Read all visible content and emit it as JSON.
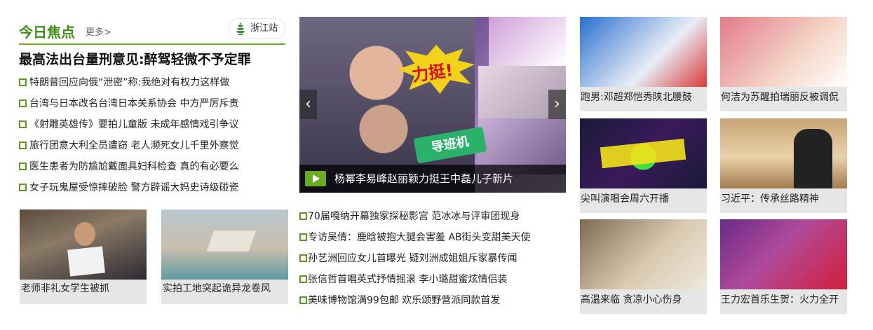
{
  "focus": {
    "title": "今日焦点",
    "more": "更多>",
    "station": "浙江站",
    "headline": "最高法出台量刑意见:醉驾轻微不予定罪",
    "items": [
      "特朗普回应向俄“泄密”称:我绝对有权力这样做",
      "台湾与日本改名台湾日本关系协会 中方严厉斥责",
      "《射雕英雄传》要拍儿童版 未成年感情戏引争议",
      "旅行团意大利全员遭窃 老人濒死女儿千里外察觉",
      "医生患者为防尴尬戴面具妇科检查 真的有必要么",
      "女子玩鬼屋受惊摔破脸 警方辟谣大妈史诗级碰瓷"
    ]
  },
  "thumbs": [
    {
      "caption": "老师非礼女学生被抓"
    },
    {
      "caption": "实拍工地突起诡异龙卷风"
    }
  ],
  "carousel": {
    "caption": "杨幂李易峰赵丽颖力挺王中磊儿子新片",
    "burst_text": "力挺!",
    "badge_text": "导班机",
    "prev_icon": "‹",
    "next_icon": "›"
  },
  "mid_list": [
    "70届嘎纳开幕独家探秘影宫 范冰冰与评审团现身",
    "专访吴倩：鹿晗被抱大腿会害羞 AB街头变甜美天使",
    "孙艺洲回应女儿首曝光 疑刘洲成姐姐斥家暴传闻",
    "张信哲首唱英式抒情摇滚 李小璐甜蜜炫情侣装",
    "美味博物馆满99包邮 欢乐颂野营派同款首发"
  ],
  "grid": [
    {
      "caption": "跑男:邓超郑恺秀陕北腰鼓",
      "colors": [
        "#2a6fd0",
        "#e8eef7"
      ]
    },
    {
      "caption": "何洁为苏醒拍瑞丽反被调侃",
      "colors": [
        "#e27a8a",
        "#f5d6c8"
      ]
    },
    {
      "caption": "尖叫演唱会周六开播",
      "colors": [
        "#1a1a3a",
        "#3fe04a"
      ]
    },
    {
      "caption": "习近平：传承丝路精神",
      "colors": [
        "#c9a477",
        "#e9d2a8"
      ]
    },
    {
      "caption": "高温来临 贪凉小心伤身",
      "colors": [
        "#7d6a52",
        "#d9c9b0"
      ]
    },
    {
      "caption": "王力宏首乐生贺：火力全开",
      "colors": [
        "#6a2a8a",
        "#d21f3a"
      ]
    }
  ]
}
